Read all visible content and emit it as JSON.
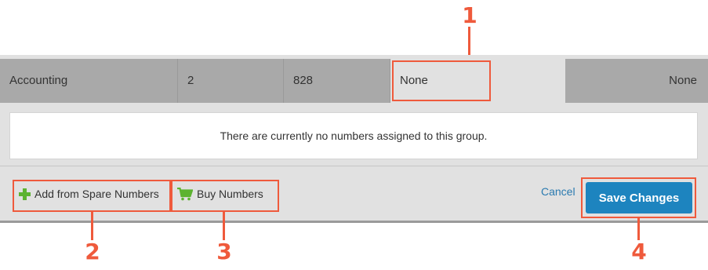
{
  "row": {
    "group_name": "Accounting",
    "col2": "2",
    "col3": "828",
    "col4": "None",
    "col5": "None"
  },
  "message": "There are currently no numbers assigned to this group.",
  "actions": {
    "add_spare_label": "Add from Spare Numbers",
    "buy_label": "Buy Numbers",
    "cancel_label": "Cancel",
    "save_label": "Save Changes"
  },
  "icons": {
    "add": "plus-icon",
    "buy": "cart-icon"
  },
  "callouts": [
    "1",
    "2",
    "3",
    "4"
  ],
  "colors": {
    "accent": "#1d84bf",
    "link": "#2a7ab0",
    "icon_green": "#5cb330",
    "callout": "#ef5a3c"
  }
}
